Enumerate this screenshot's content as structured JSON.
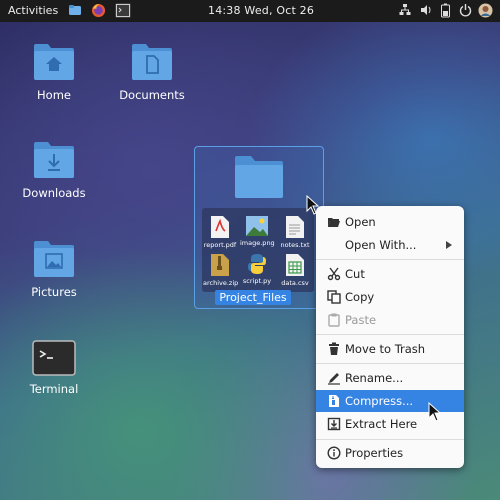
{
  "topbar": {
    "activities": "Activities",
    "clock": "14:38  Wed, Oct 26",
    "apps": [
      "files-icon",
      "firefox-icon",
      "terminal-icon"
    ],
    "tray": [
      "network-icon",
      "volume-icon",
      "battery-icon",
      "power-icon",
      "avatar"
    ]
  },
  "desktop": {
    "items": [
      {
        "label": "Home"
      },
      {
        "label": "Documents"
      },
      {
        "label": "Downloads"
      },
      {
        "label": "Pictures"
      },
      {
        "label": "Terminal"
      }
    ],
    "selected_folder": {
      "name": "Project_Files",
      "files": [
        "report.pdf",
        "image.png",
        "notes.txt",
        "archive.zip",
        "script.py",
        "data.csv"
      ]
    }
  },
  "context_menu": {
    "items": [
      {
        "label": "Open",
        "icon": "folder-open-icon"
      },
      {
        "label": "Open With...",
        "icon": "",
        "submenu": true
      },
      {
        "label": "Cut",
        "icon": "scissors-icon"
      },
      {
        "label": "Copy",
        "icon": "copy-icon"
      },
      {
        "label": "Paste",
        "icon": "paste-icon",
        "disabled": true
      },
      {
        "label": "Move to Trash",
        "icon": "trash-icon"
      },
      {
        "label": "Rename...",
        "icon": "pencil-icon"
      },
      {
        "label": "Compress...",
        "icon": "archive-icon",
        "highlighted": true
      },
      {
        "label": "Extract Here",
        "icon": "extract-icon"
      },
      {
        "label": "Properties",
        "icon": "info-icon"
      }
    ]
  },
  "colors": {
    "accent": "#3584e4",
    "folder": "#5fa3e0",
    "topbar": "#1b1b1b"
  }
}
